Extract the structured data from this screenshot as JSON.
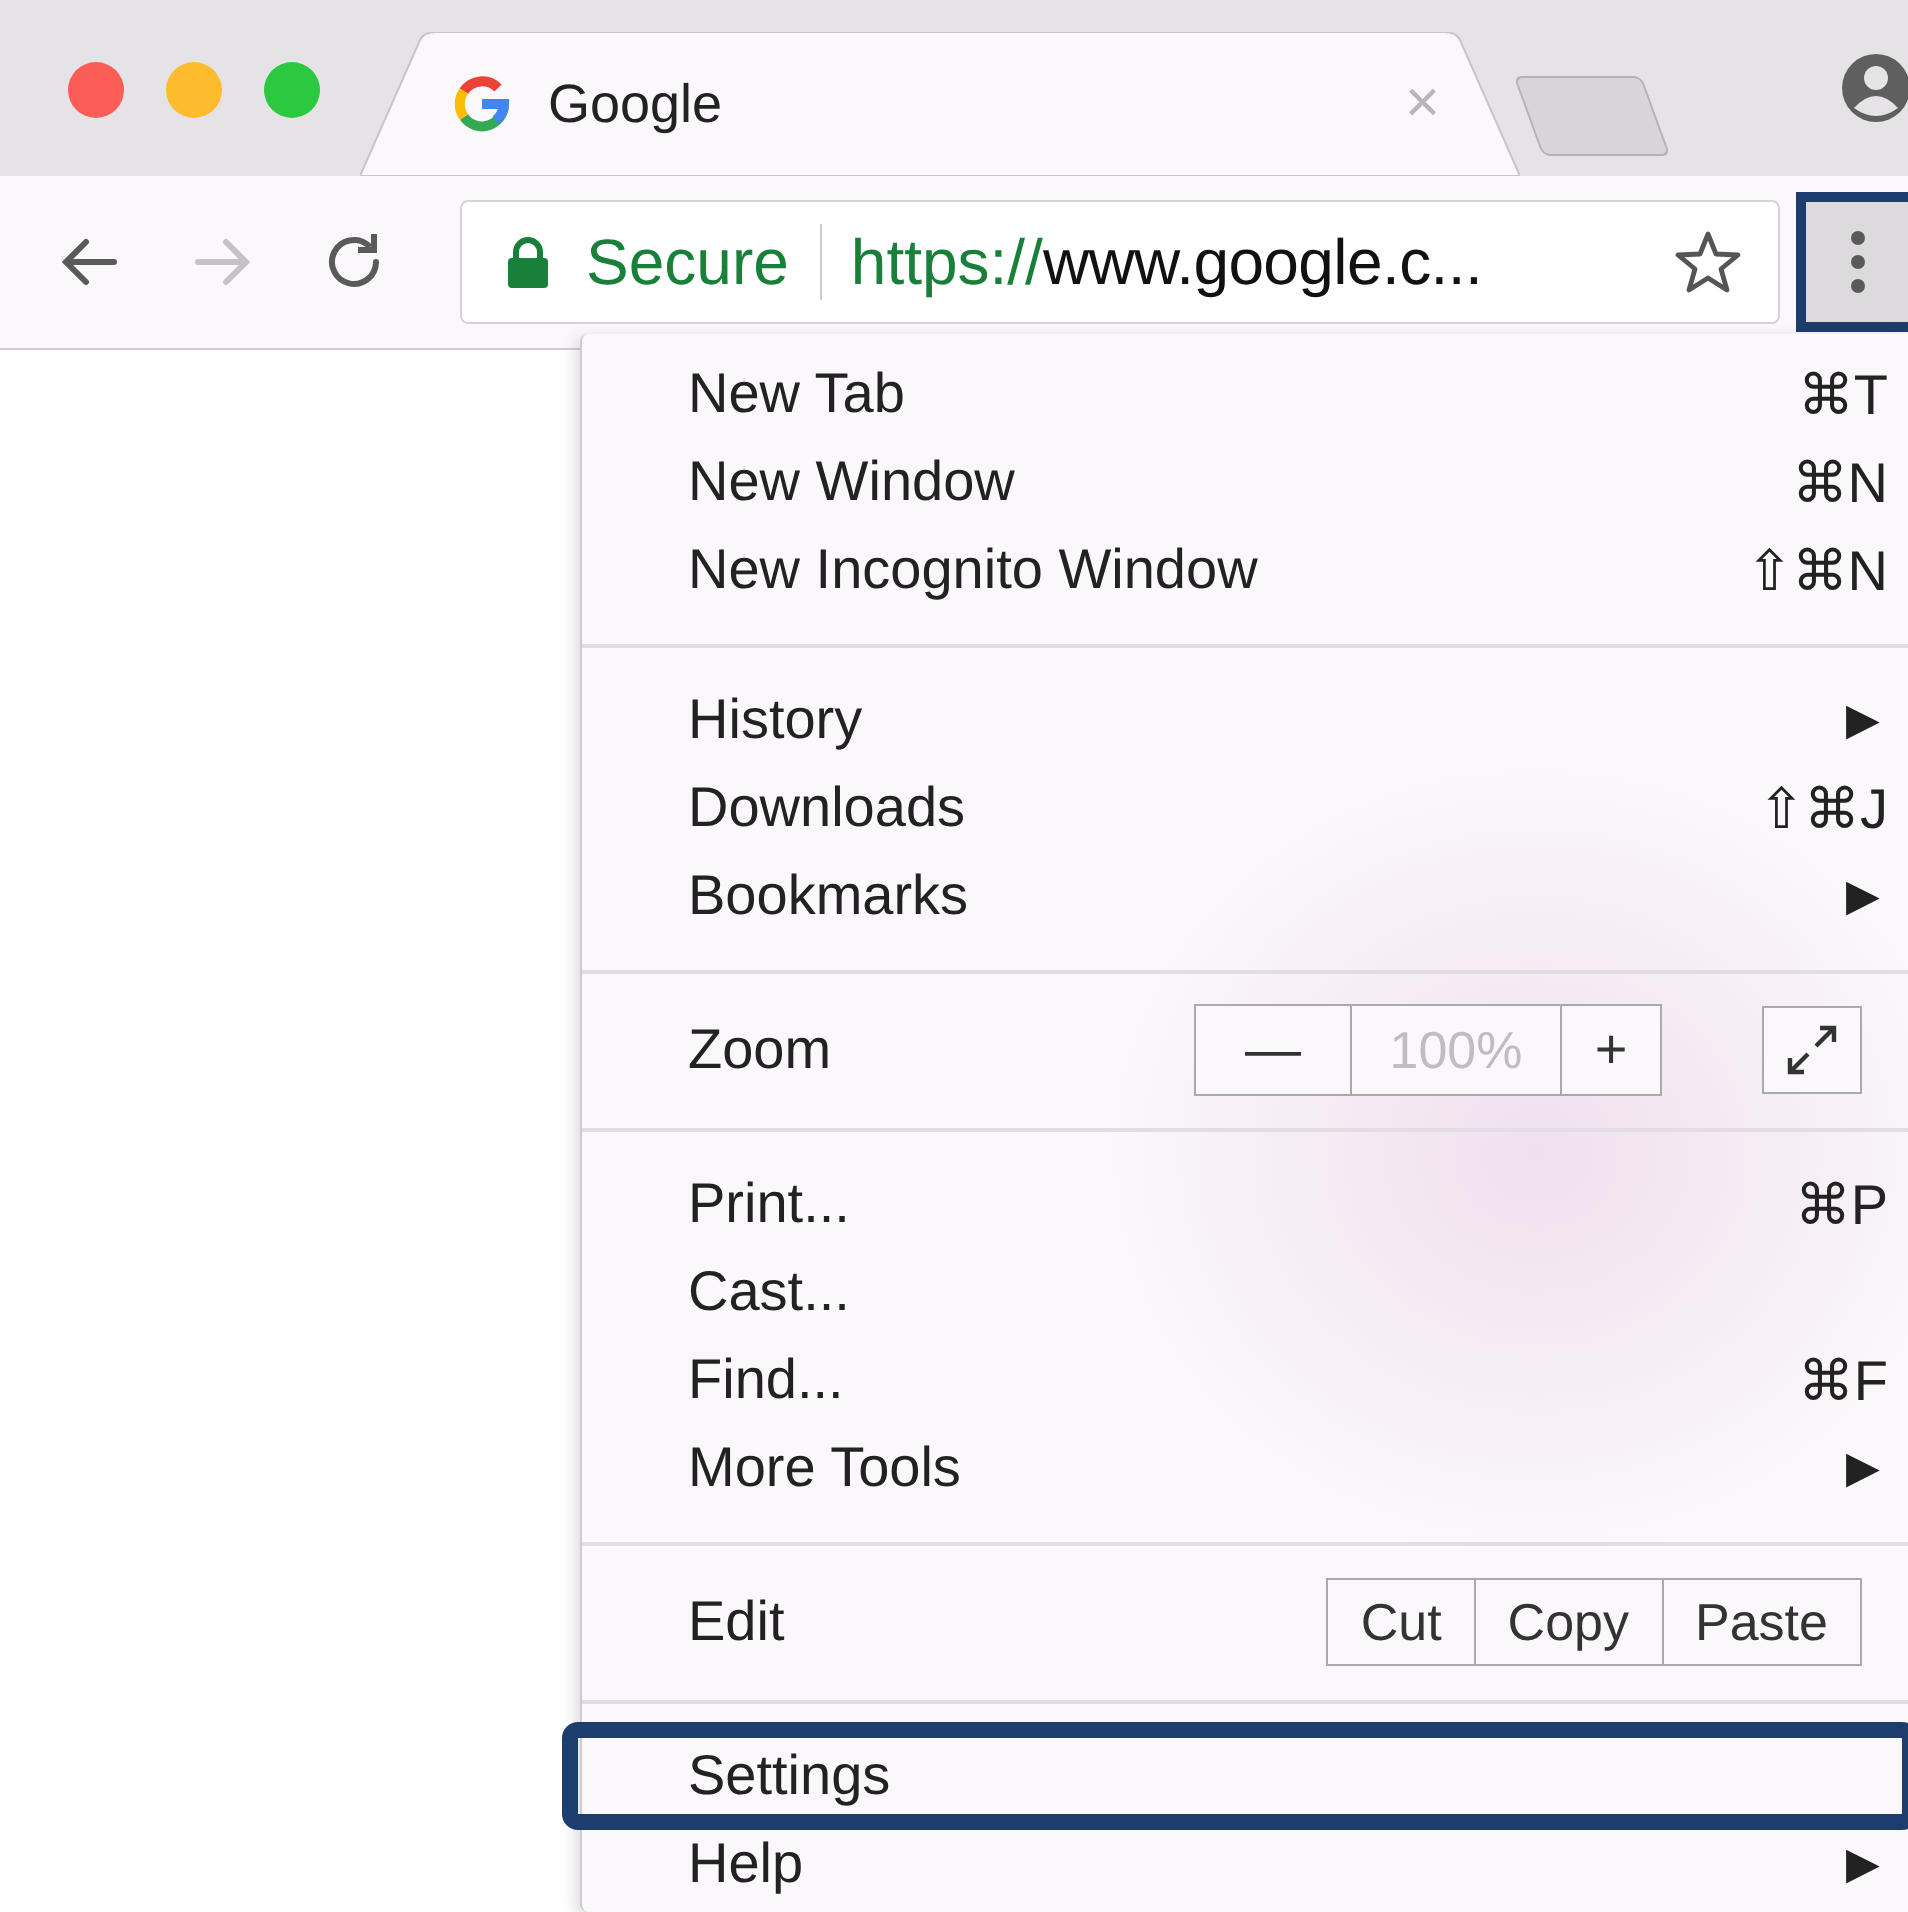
{
  "tab_strip": {
    "tabs": [
      {
        "title": "Google",
        "close": "×",
        "selected": true
      }
    ]
  },
  "toolbar": {
    "nav_buttons": [
      {
        "kind": "back",
        "disabled": false
      },
      {
        "kind": "forward",
        "disabled": true
      },
      {
        "kind": "reload",
        "disabled": false
      }
    ],
    "address_bar": {
      "security": "Secure",
      "url_scheme": "https://",
      "url_rest": "www.google.c...",
      "bookmarked": false
    },
    "menu_button": {
      "highlighted": true
    }
  },
  "menu": {
    "groups": [
      {
        "items": [
          {
            "kind": "item",
            "label": "New Tab",
            "shortcut": "⌘T",
            "highlighted": false
          },
          {
            "kind": "item",
            "label": "New Window",
            "shortcut": "⌘N",
            "highlighted": false
          },
          {
            "kind": "item",
            "label": "New Incognito Window",
            "shortcut": "⇧⌘N",
            "highlighted": false
          }
        ]
      },
      {
        "items": [
          {
            "kind": "submenu",
            "label": "History",
            "arrow": "▶",
            "highlighted": false
          },
          {
            "kind": "item",
            "label": "Downloads",
            "shortcut": "⇧⌘J",
            "highlighted": false
          },
          {
            "kind": "submenu",
            "label": "Bookmarks",
            "arrow": "▶",
            "highlighted": false
          }
        ]
      },
      {
        "items": [
          {
            "kind": "zoom",
            "label": "Zoom",
            "minus": "—",
            "value": "100%",
            "plus": "+",
            "highlighted": false
          }
        ]
      },
      {
        "items": [
          {
            "kind": "item",
            "label": "Print...",
            "shortcut": "⌘P",
            "highlighted": false
          },
          {
            "kind": "item",
            "label": "Cast...",
            "highlighted": false
          },
          {
            "kind": "item",
            "label": "Find...",
            "shortcut": "⌘F",
            "highlighted": false
          },
          {
            "kind": "submenu",
            "label": "More Tools",
            "arrow": "▶",
            "highlighted": false
          }
        ]
      },
      {
        "items": [
          {
            "kind": "edit",
            "label": "Edit",
            "buttons": [
              "Cut",
              "Copy",
              "Paste"
            ],
            "highlighted": false
          }
        ]
      },
      {
        "items": [
          {
            "kind": "item",
            "label": "Settings",
            "highlighted": true
          },
          {
            "kind": "submenu",
            "label": "Help",
            "arrow": "▶",
            "highlighted": false
          }
        ]
      }
    ]
  }
}
